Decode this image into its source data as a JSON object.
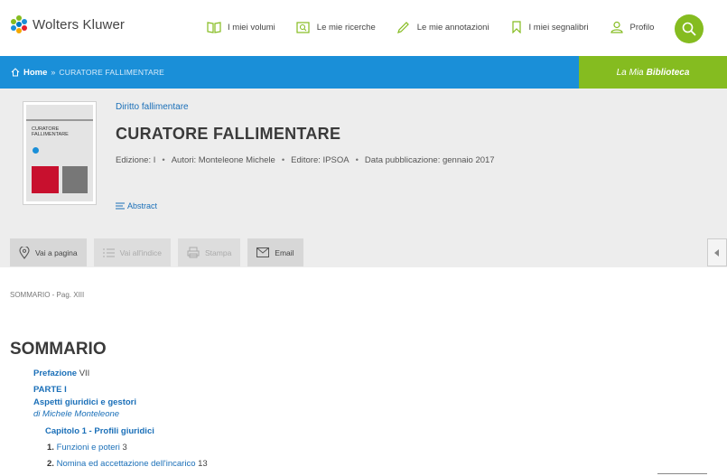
{
  "header": {
    "brand": "Wolters Kluwer",
    "nav": [
      {
        "label": "I miei volumi",
        "icon": "book-icon"
      },
      {
        "label": "Le mie ricerche",
        "icon": "search-folder-icon"
      },
      {
        "label": "Le mie annotazioni",
        "icon": "pencil-icon"
      },
      {
        "label": "I miei segnalibri",
        "icon": "bookmark-icon"
      },
      {
        "label": "Profilo",
        "icon": "user-icon"
      }
    ],
    "search_icon": "search-icon"
  },
  "breadcrumb": {
    "home": "Home",
    "separator": "»",
    "current": "CURATORE FALLIMENTARE"
  },
  "library": {
    "prefix": "La Mia",
    "bold": "Biblioteca"
  },
  "book": {
    "category": "Diritto fallimentare",
    "title": "CURATORE FALLIMENTARE",
    "meta": {
      "edition": "Edizione: I",
      "authors": "Autori: Monteleone Michele",
      "publisher": "Editore: IPSOA",
      "date": "Data pubblicazione: gennaio 2017"
    },
    "abstract": "Abstract",
    "cover_title": "CURATORE FALLIMENTARE"
  },
  "tools": {
    "goto_page": "Vai a pagina",
    "goto_index": "Vai all'indice",
    "print": "Stampa",
    "email": "Email"
  },
  "colors": {
    "brand_blue": "#1a8fd8",
    "brand_green": "#85bc20",
    "link": "#1a6fb8"
  },
  "content": {
    "page_ref": "SOMMARIO - Pag. XIII",
    "heading": "SOMMARIO",
    "toc": {
      "prefazione": "Prefazione",
      "prefazione_page": "VII",
      "part": "PARTE I",
      "part_title": "Aspetti giuridici e gestori",
      "author": "di Michele Monteleone",
      "chapter": "Capitolo 1 - Profili giuridici",
      "item1_num": "1.",
      "item1": "Funzioni e poteri",
      "item1_page": "3",
      "item2_num": "2.",
      "item2": "Nomina ed accettazione dell'incarico",
      "item2_page": "13"
    }
  }
}
